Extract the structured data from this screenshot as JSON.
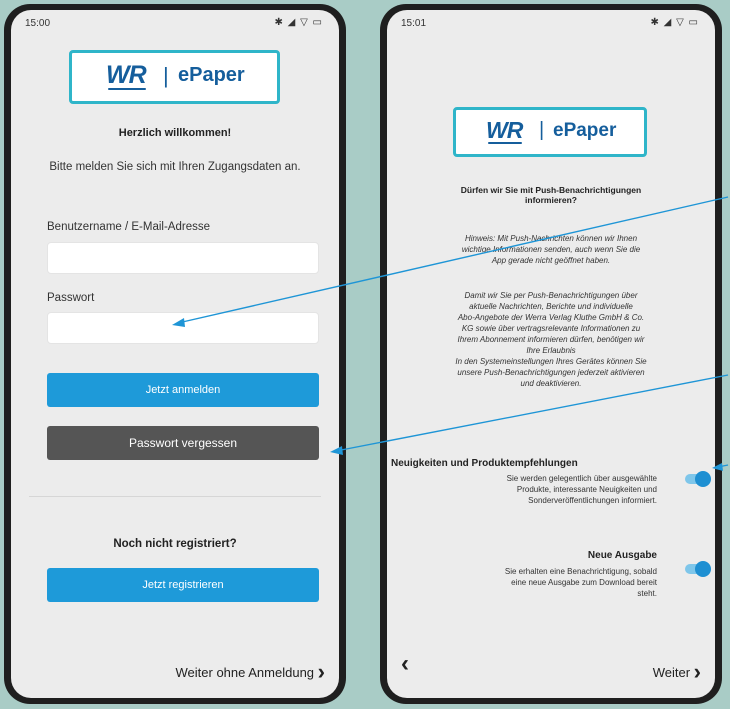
{
  "left_phone": {
    "status": {
      "time": "15:00",
      "icons": "✱ ◢ ▽ ▭"
    },
    "logo": {
      "brand": "WR",
      "separator": "|",
      "word": "ePaper"
    },
    "welcome_title": "Herzlich willkommen!",
    "welcome_subtitle": "Bitte melden Sie sich mit Ihren Zugangsdaten an.",
    "username": {
      "label": "Benutzername / E-Mail-Adresse",
      "value": "",
      "placeholder": ""
    },
    "password": {
      "label": "Passwort",
      "value": "",
      "placeholder": ""
    },
    "login_button": "Jetzt anmelden",
    "forgot_button": "Passwort vergessen",
    "register_prompt": "Noch nicht registriert?",
    "register_button": "Jetzt registrieren",
    "continue_link": "Weiter ohne Anmeldung",
    "continue_chevron": "›"
  },
  "right_phone": {
    "status": {
      "time": "15:01",
      "icons": "✱ ◢ ▽ ▭"
    },
    "logo": {
      "brand": "WR",
      "separator": "|",
      "word": "ePaper"
    },
    "question": [
      "Dürfen wir Sie mit Push-Benachrichtigungen",
      "informieren?"
    ],
    "hint": [
      "Hinweis: Mit Push-Nachrichten können wir Ihnen",
      "wichtige Informationen senden, auch wenn Sie die",
      "App gerade nicht geöffnet haben."
    ],
    "consent": [
      "Damit wir Sie per Push-Benachrichtigungen über",
      "aktuelle Nachrichten, Berichte und individuelle",
      "Abo-Angebote der Werra Verlag Kluthe GmbH & Co.",
      "KG sowie über vertragsrelevante Informationen zu",
      "Ihrem Abonnement informieren dürfen, benötigen wir",
      "Ihre Erlaubnis",
      "In den Systemeinstellungen Ihres Gerätes können Sie",
      "unsere Push-Benachrichtigungen jederzeit aktivieren",
      "und deaktivieren."
    ],
    "setting1": {
      "title": "Neuigkeiten und Produktempfehlungen",
      "desc": [
        "Sie werden gelegentlich über ausgewählte",
        "Produkte, interessante Neuigkeiten und",
        "Sonderveröffentlichungen informiert."
      ],
      "enabled": true
    },
    "setting2": {
      "title": "Neue Ausgabe",
      "desc": [
        "Sie erhalten eine Benachrichtigung, sobald",
        "eine neue Ausgabe zum Download bereit",
        "steht."
      ],
      "enabled": true
    },
    "back_chevron": "‹",
    "next_link": "Weiter",
    "next_chevron": "›"
  },
  "colors": {
    "accent_blue": "#1e9ad9",
    "logo_border": "#2fb5c9",
    "logo_text": "#155e9c",
    "gray_button": "#555555",
    "background": "#a9ccc6"
  },
  "icons": [
    "back-chevron-icon",
    "next-chevron-icon",
    "bluetooth-icon",
    "signal-icon",
    "wifi-icon",
    "battery-icon"
  ]
}
